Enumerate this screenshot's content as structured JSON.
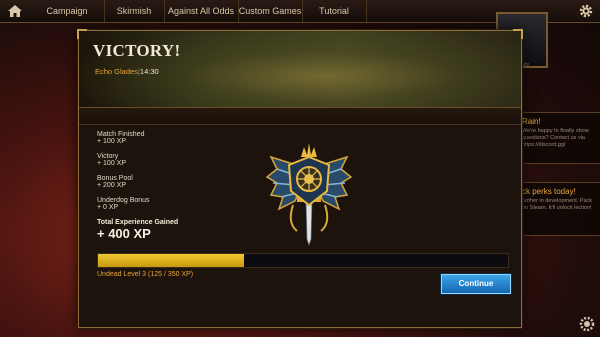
{
  "nav": {
    "items": [
      {
        "label": "Campaign"
      },
      {
        "label": "Skirmish"
      },
      {
        "label": "Against All Odds"
      },
      {
        "label": "Custom Games"
      },
      {
        "label": "Tutorial"
      }
    ],
    "home_icon": "home-icon",
    "settings_icon": "gear-icon"
  },
  "background": {
    "portrait_sub": "...ity",
    "panel1": {
      "heading": "Rain!",
      "text": "We're happy to finally show questions? Contact us via https://discord.gg/"
    },
    "panel2": {
      "heading": "ck perks today!",
      "text": "further in development. Pack on Steam. It'll unlock lection!"
    }
  },
  "modal": {
    "title": "VICTORY!",
    "map_name": "Echo Glades",
    "separator": "|",
    "match_time": "14:30",
    "rewards": [
      {
        "label": "Match Finished",
        "value": "+ 100 XP"
      },
      {
        "label": "Victory",
        "value": "+ 100 XP"
      },
      {
        "label": "Bonus Pool",
        "value": "+ 200 XP"
      },
      {
        "label": "Underdog Bonus",
        "value": "+ 0 XP"
      }
    ],
    "total_label": "Total Experience Gained",
    "total_value": "+ 400 XP",
    "xp_progress": 0.357,
    "level_text": "Undead Level 3 (125 / 350 XP)",
    "continue_label": "Continue",
    "crest_icon": "undead-faction-crest-icon"
  },
  "colors": {
    "accent_gold": "#e6a43a",
    "xp_fill": "#f0c830",
    "button_blue": "#2a88d0"
  }
}
